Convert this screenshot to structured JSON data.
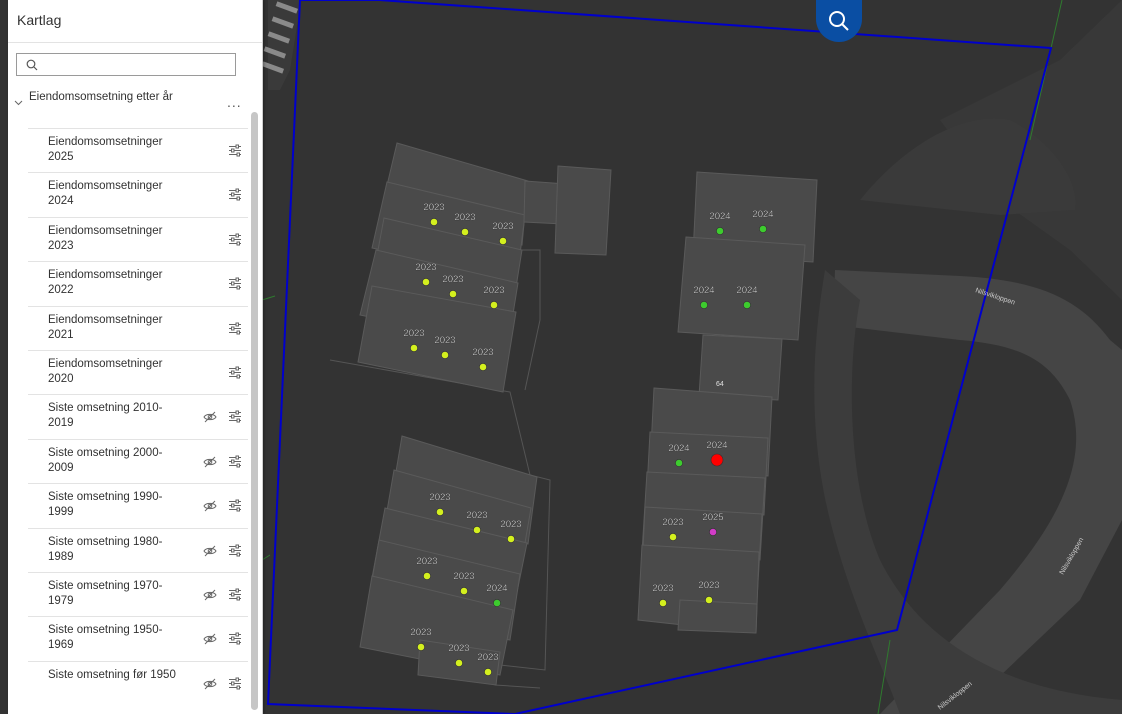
{
  "panel": {
    "title": "Kartlag",
    "search": {
      "placeholder": "",
      "value": ""
    },
    "group": {
      "label": "Eiendomsomsetning etter år",
      "more": "..."
    },
    "layers": [
      {
        "label": "Eiendomsomsetninger 2025",
        "visible": true
      },
      {
        "label": "Eiendomsomsetninger 2024",
        "visible": true
      },
      {
        "label": "Eiendomsomsetninger 2023",
        "visible": true
      },
      {
        "label": "Eiendomsomsetninger 2022",
        "visible": true
      },
      {
        "label": "Eiendomsomsetninger 2021",
        "visible": true
      },
      {
        "label": "Eiendomsomsetninger 2020",
        "visible": true
      },
      {
        "label": "Siste omsetning 2010-2019",
        "visible": false
      },
      {
        "label": "Siste omsetning 2000-2009",
        "visible": false
      },
      {
        "label": "Siste omsetning 1990-1999",
        "visible": false
      },
      {
        "label": "Siste omsetning 1980-1989",
        "visible": false
      },
      {
        "label": "Siste omsetning 1970-1979",
        "visible": false
      },
      {
        "label": "Siste omsetning 1950-1969",
        "visible": false
      },
      {
        "label": "Siste omsetning før 1950",
        "visible": false
      }
    ]
  },
  "map": {
    "road_labels": [
      "Nilsvikloppen",
      "Nilsvikloppen",
      "Nilsvikloppen"
    ],
    "house_number": "64",
    "colors": {
      "background": "#333333",
      "building": "#4a4a4a",
      "boundary": "#0000cc",
      "y2023": "#d4f01e",
      "y2024": "#3dcc2e",
      "y2025": "#d23cc8",
      "highlight": "#ff0000"
    },
    "sales": [
      {
        "year": "2023",
        "color": "y2023"
      },
      {
        "year": "2023",
        "color": "y2023"
      },
      {
        "year": "2023",
        "color": "y2023"
      },
      {
        "year": "2023",
        "color": "y2023"
      },
      {
        "year": "2023",
        "color": "y2023"
      },
      {
        "year": "2023",
        "color": "y2023"
      },
      {
        "year": "2023",
        "color": "y2023"
      },
      {
        "year": "2023",
        "color": "y2023"
      },
      {
        "year": "2023",
        "color": "y2023"
      },
      {
        "year": "2023",
        "color": "y2023"
      },
      {
        "year": "2023",
        "color": "y2023"
      },
      {
        "year": "2023",
        "color": "y2023"
      },
      {
        "year": "2023",
        "color": "y2023"
      },
      {
        "year": "2023",
        "color": "y2023"
      },
      {
        "year": "2024",
        "color": "y2024"
      },
      {
        "year": "2023",
        "color": "y2023"
      },
      {
        "year": "2023",
        "color": "y2023"
      },
      {
        "year": "2023",
        "color": "y2023"
      },
      {
        "year": "2024",
        "color": "y2024"
      },
      {
        "year": "2024",
        "color": "y2024"
      },
      {
        "year": "2024",
        "color": "y2024"
      },
      {
        "year": "2024",
        "color": "y2024"
      },
      {
        "year": "2024",
        "color": "y2024"
      },
      {
        "year": "2024",
        "color": "highlight"
      },
      {
        "year": "2023",
        "color": "y2023"
      },
      {
        "year": "2025",
        "color": "y2025"
      },
      {
        "year": "2023",
        "color": "y2023"
      },
      {
        "year": "2023",
        "color": "y2023"
      }
    ]
  }
}
